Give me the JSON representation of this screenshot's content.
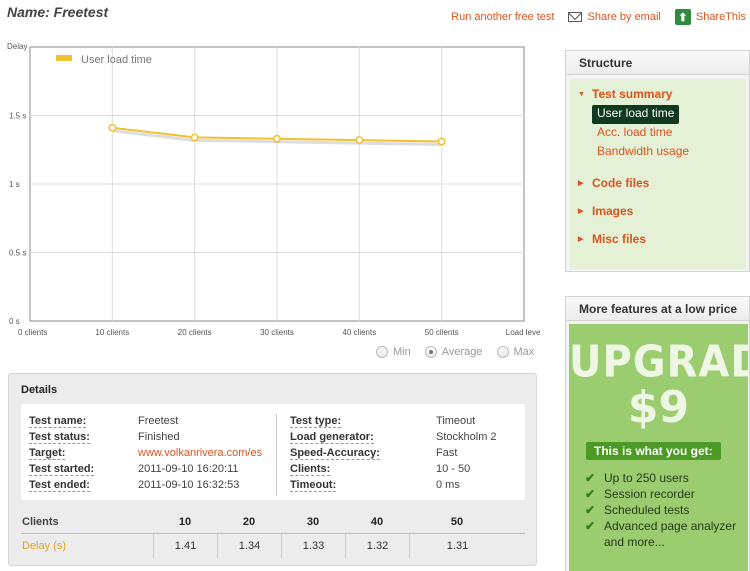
{
  "page": {
    "title": "Name: Freetest"
  },
  "actions": {
    "run_another": "Run another free test",
    "share_email": "Share by email",
    "share_this": "ShareThis"
  },
  "chart_data": {
    "type": "line",
    "ylabel": "Delay",
    "xlabel": "Load level",
    "x_ticks": [
      "0 clients",
      "10 clients",
      "20 clients",
      "30 clients",
      "40 clients",
      "50 clients",
      "Load level"
    ],
    "y_ticks": [
      "0 s",
      "0.5 s",
      "1 s",
      "1.5 s"
    ],
    "ylim": [
      0,
      2
    ],
    "grid": true,
    "legend": "top-left",
    "series": [
      {
        "name": "User load time",
        "color": "#f0c030",
        "x": [
          10,
          20,
          30,
          40,
          50
        ],
        "values": [
          1.41,
          1.34,
          1.33,
          1.32,
          1.31
        ]
      }
    ]
  },
  "aggregate": {
    "options": [
      "Min",
      "Average",
      "Max"
    ],
    "selected": "Average"
  },
  "details": {
    "heading": "Details",
    "left": [
      {
        "label": "Test name:",
        "value": "Freetest"
      },
      {
        "label": "Test status:",
        "value": "Finished"
      },
      {
        "label": "Target:",
        "value": "www.volkanrivera.com/es"
      },
      {
        "label": "Test started:",
        "value": "2011-09-10 16:20:11"
      },
      {
        "label": "Test ended:",
        "value": "2011-09-10 16:32:53"
      }
    ],
    "right": [
      {
        "label": "Test type:",
        "value": "Timeout"
      },
      {
        "label": "Load generator:",
        "value": "Stockholm 2"
      },
      {
        "label": "Speed-Accuracy:",
        "value": "Fast"
      },
      {
        "label": "Clients:",
        "value": "10 - 50"
      },
      {
        "label": "Timeout:",
        "value": "0 ms"
      }
    ],
    "table": {
      "head_label": "Clients",
      "row_label": "Delay (s)",
      "clients": [
        "10",
        "20",
        "30",
        "40",
        "50"
      ],
      "delays": [
        "1.41",
        "1.34",
        "1.33",
        "1.32",
        "1.31"
      ]
    }
  },
  "structure": {
    "title": "Structure",
    "nodes": [
      {
        "label": "Test summary",
        "expanded": true,
        "children": [
          "User load time",
          "Acc. load time",
          "Bandwidth usage"
        ]
      },
      {
        "label": "Code files"
      },
      {
        "label": "Images"
      },
      {
        "label": "Misc files"
      }
    ],
    "active_child": "User load time"
  },
  "upgrade": {
    "title": "More features at a low price",
    "word": "UPGRADE",
    "price": "$9",
    "you_get": "This is what you get:",
    "features": [
      "Up to 250 users",
      "Session recorder",
      "Scheduled tests",
      "Advanced page analyzer",
      "and more..."
    ]
  }
}
